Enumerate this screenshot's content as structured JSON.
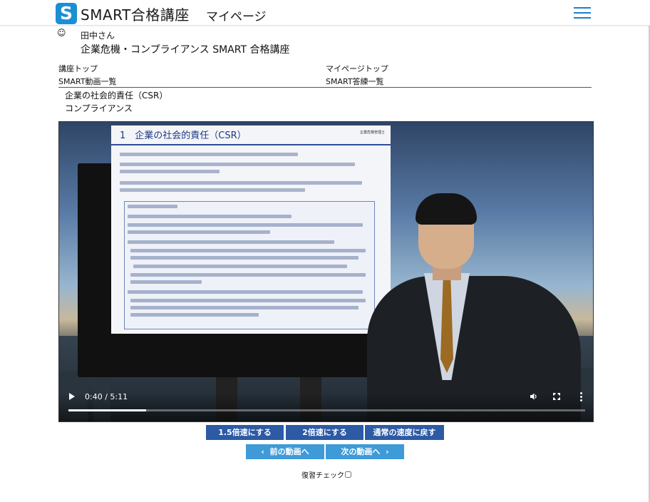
{
  "header": {
    "logo_letter": "S",
    "brand": "SMART合格講座",
    "page": "マイページ",
    "menu_icon": "hamburger-menu-icon",
    "accent_color": "#1b8fd4"
  },
  "user": {
    "icon": "smiley-icon",
    "name": "田中さん",
    "course": "企業危機・コンプライアンス SMART 合格講座"
  },
  "nav": {
    "course_top": "講座トップ",
    "mypage_top": "マイページトップ",
    "video_list": "SMART動画一覧",
    "answer_list": "SMART答練一覧"
  },
  "lecture": {
    "title": "企業の社会的責任（CSR）",
    "category": "コンプライアンス"
  },
  "video": {
    "time": "0:40 / 5:11",
    "progress_fraction": 0.15,
    "slide": {
      "heading": "1　企業の社会的責任（CSR）",
      "corner": "企業危機管理士"
    }
  },
  "buttons": {
    "speed_15": "1.5倍速にする",
    "speed_2": "2倍速にする",
    "speed_normal": "通常の速度に戻す",
    "prev": "前の動画へ",
    "next": "次の動画へ",
    "speed_color": "#2c5aa5",
    "nav_color": "#3f9ad8"
  },
  "review": {
    "label": "復習チェック"
  }
}
